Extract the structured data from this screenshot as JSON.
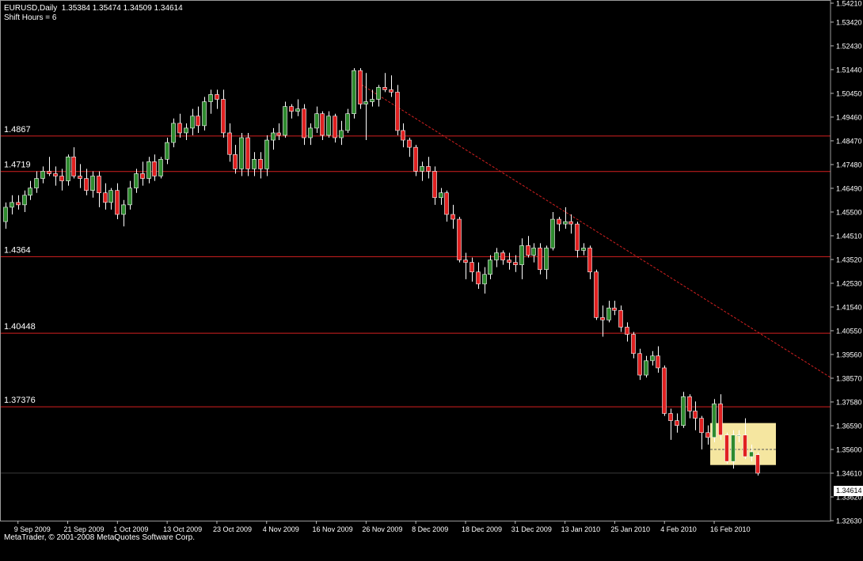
{
  "header": {
    "symbol_line": "EURUSD,Daily  1.35384 1.35474 1.34509 1.34614",
    "shift_line": "Shift Hours = 6"
  },
  "footer": {
    "copyright": "MetaTrader, © 2001-2008 MetaQuotes Software Corp."
  },
  "colors": {
    "background": "#000000",
    "bull": "#2e8b2e",
    "bear": "#e02020",
    "level_line": "#d42020",
    "grid": "#2a2a2a",
    "axis_text": "#ffffff",
    "highlight": "#f5e6a0"
  },
  "chart_data": {
    "type": "candlestick",
    "symbol": "EURUSD",
    "timeframe": "Daily",
    "current_price": "1.34614",
    "y_ticks": [
      "1.54210",
      "1.53420",
      "1.52430",
      "1.51440",
      "1.50450",
      "1.49460",
      "1.48470",
      "1.47480",
      "1.46490",
      "1.45500",
      "1.44510",
      "1.43520",
      "1.42530",
      "1.41540",
      "1.40550",
      "1.39560",
      "1.38570",
      "1.37580",
      "1.36590",
      "1.35600",
      "1.34610",
      "1.33620",
      "1.32630"
    ],
    "x_ticks": [
      "9 Sep 2009",
      "21 Sep 2009",
      "1 Oct 2009",
      "13 Oct 2009",
      "23 Oct 2009",
      "4 Nov 2009",
      "16 Nov 2009",
      "26 Nov 2009",
      "8 Dec 2009",
      "18 Dec 2009",
      "31 Dec 2009",
      "13 Jan 2010",
      "25 Jan 2010",
      "4 Feb 2010",
      "16 Feb 2010"
    ],
    "levels": [
      {
        "label": "1.4867",
        "value": 1.4867
      },
      {
        "label": "1.4719",
        "value": 1.4719
      },
      {
        "label": "1.4364",
        "value": 1.4364
      },
      {
        "label": "1.40448",
        "value": 1.40448
      },
      {
        "label": "1.37376",
        "value": 1.37376
      }
    ],
    "trendline": {
      "from": {
        "date": "27 Nov 2009",
        "price": 1.509
      },
      "to": {
        "date": "extends beyond 25 Feb 2010",
        "price": 1.386
      }
    },
    "highlight_box": {
      "from": "16 Feb 2010",
      "to": "25 Feb 2010",
      "price_high": 1.367,
      "price_low": 1.3495,
      "mid": 1.356
    },
    "candles": [
      {
        "date": "2009-09-07",
        "o": 1.451,
        "h": 1.459,
        "l": 1.448,
        "c": 1.457
      },
      {
        "date": "2009-09-08",
        "o": 1.457,
        "h": 1.462,
        "l": 1.454,
        "c": 1.459
      },
      {
        "date": "2009-09-09",
        "o": 1.459,
        "h": 1.462,
        "l": 1.456,
        "c": 1.458
      },
      {
        "date": "2009-09-10",
        "o": 1.458,
        "h": 1.464,
        "l": 1.455,
        "c": 1.462
      },
      {
        "date": "2009-09-11",
        "o": 1.462,
        "h": 1.468,
        "l": 1.46,
        "c": 1.465
      },
      {
        "date": "2009-09-14",
        "o": 1.465,
        "h": 1.472,
        "l": 1.463,
        "c": 1.469
      },
      {
        "date": "2009-09-15",
        "o": 1.469,
        "h": 1.474,
        "l": 1.467,
        "c": 1.472
      },
      {
        "date": "2009-09-16",
        "o": 1.472,
        "h": 1.478,
        "l": 1.47,
        "c": 1.471
      },
      {
        "date": "2009-09-17",
        "o": 1.471,
        "h": 1.474,
        "l": 1.466,
        "c": 1.47
      },
      {
        "date": "2009-09-18",
        "o": 1.47,
        "h": 1.473,
        "l": 1.464,
        "c": 1.468
      },
      {
        "date": "2009-09-21",
        "o": 1.468,
        "h": 1.479,
        "l": 1.466,
        "c": 1.478
      },
      {
        "date": "2009-09-22",
        "o": 1.478,
        "h": 1.482,
        "l": 1.469,
        "c": 1.47
      },
      {
        "date": "2009-09-23",
        "o": 1.47,
        "h": 1.475,
        "l": 1.465,
        "c": 1.469
      },
      {
        "date": "2009-09-24",
        "o": 1.469,
        "h": 1.473,
        "l": 1.462,
        "c": 1.464
      },
      {
        "date": "2009-09-25",
        "o": 1.464,
        "h": 1.472,
        "l": 1.461,
        "c": 1.47
      },
      {
        "date": "2009-09-28",
        "o": 1.47,
        "h": 1.472,
        "l": 1.457,
        "c": 1.463
      },
      {
        "date": "2009-09-29",
        "o": 1.463,
        "h": 1.467,
        "l": 1.456,
        "c": 1.459
      },
      {
        "date": "2009-09-30",
        "o": 1.459,
        "h": 1.465,
        "l": 1.456,
        "c": 1.464
      },
      {
        "date": "2009-10-01",
        "o": 1.464,
        "h": 1.467,
        "l": 1.452,
        "c": 1.454
      },
      {
        "date": "2009-10-02",
        "o": 1.454,
        "h": 1.46,
        "l": 1.449,
        "c": 1.458
      },
      {
        "date": "2009-10-05",
        "o": 1.458,
        "h": 1.468,
        "l": 1.456,
        "c": 1.465
      },
      {
        "date": "2009-10-06",
        "o": 1.465,
        "h": 1.473,
        "l": 1.463,
        "c": 1.471
      },
      {
        "date": "2009-10-07",
        "o": 1.471,
        "h": 1.476,
        "l": 1.466,
        "c": 1.469
      },
      {
        "date": "2009-10-08",
        "o": 1.469,
        "h": 1.478,
        "l": 1.467,
        "c": 1.476
      },
      {
        "date": "2009-10-09",
        "o": 1.476,
        "h": 1.479,
        "l": 1.468,
        "c": 1.47
      },
      {
        "date": "2009-10-12",
        "o": 1.47,
        "h": 1.478,
        "l": 1.469,
        "c": 1.477
      },
      {
        "date": "2009-10-13",
        "o": 1.477,
        "h": 1.486,
        "l": 1.475,
        "c": 1.484
      },
      {
        "date": "2009-10-14",
        "o": 1.484,
        "h": 1.494,
        "l": 1.482,
        "c": 1.492
      },
      {
        "date": "2009-10-15",
        "o": 1.492,
        "h": 1.496,
        "l": 1.486,
        "c": 1.488
      },
      {
        "date": "2009-10-16",
        "o": 1.488,
        "h": 1.492,
        "l": 1.485,
        "c": 1.49
      },
      {
        "date": "2009-10-19",
        "o": 1.49,
        "h": 1.498,
        "l": 1.487,
        "c": 1.495
      },
      {
        "date": "2009-10-20",
        "o": 1.495,
        "h": 1.499,
        "l": 1.488,
        "c": 1.491
      },
      {
        "date": "2009-10-21",
        "o": 1.491,
        "h": 1.503,
        "l": 1.489,
        "c": 1.501
      },
      {
        "date": "2009-10-22",
        "o": 1.501,
        "h": 1.506,
        "l": 1.496,
        "c": 1.504
      },
      {
        "date": "2009-10-23",
        "o": 1.504,
        "h": 1.506,
        "l": 1.498,
        "c": 1.502
      },
      {
        "date": "2009-10-26",
        "o": 1.502,
        "h": 1.506,
        "l": 1.486,
        "c": 1.488
      },
      {
        "date": "2009-10-27",
        "o": 1.488,
        "h": 1.492,
        "l": 1.476,
        "c": 1.479
      },
      {
        "date": "2009-10-28",
        "o": 1.479,
        "h": 1.483,
        "l": 1.471,
        "c": 1.473
      },
      {
        "date": "2009-10-29",
        "o": 1.473,
        "h": 1.488,
        "l": 1.47,
        "c": 1.486
      },
      {
        "date": "2009-10-30",
        "o": 1.486,
        "h": 1.488,
        "l": 1.47,
        "c": 1.473
      },
      {
        "date": "2009-11-02",
        "o": 1.473,
        "h": 1.48,
        "l": 1.47,
        "c": 1.477
      },
      {
        "date": "2009-11-03",
        "o": 1.477,
        "h": 1.48,
        "l": 1.469,
        "c": 1.473
      },
      {
        "date": "2009-11-04",
        "o": 1.473,
        "h": 1.487,
        "l": 1.47,
        "c": 1.485
      },
      {
        "date": "2009-11-05",
        "o": 1.485,
        "h": 1.49,
        "l": 1.481,
        "c": 1.488
      },
      {
        "date": "2009-11-06",
        "o": 1.488,
        "h": 1.492,
        "l": 1.485,
        "c": 1.487
      },
      {
        "date": "2009-11-09",
        "o": 1.487,
        "h": 1.501,
        "l": 1.486,
        "c": 1.499
      },
      {
        "date": "2009-11-10",
        "o": 1.499,
        "h": 1.5,
        "l": 1.494,
        "c": 1.497
      },
      {
        "date": "2009-11-11",
        "o": 1.497,
        "h": 1.502,
        "l": 1.495,
        "c": 1.498
      },
      {
        "date": "2009-11-12",
        "o": 1.498,
        "h": 1.5,
        "l": 1.483,
        "c": 1.486
      },
      {
        "date": "2009-11-13",
        "o": 1.486,
        "h": 1.492,
        "l": 1.483,
        "c": 1.49
      },
      {
        "date": "2009-11-16",
        "o": 1.49,
        "h": 1.499,
        "l": 1.488,
        "c": 1.496
      },
      {
        "date": "2009-11-17",
        "o": 1.496,
        "h": 1.497,
        "l": 1.485,
        "c": 1.487
      },
      {
        "date": "2009-11-18",
        "o": 1.487,
        "h": 1.497,
        "l": 1.486,
        "c": 1.495
      },
      {
        "date": "2009-11-19",
        "o": 1.495,
        "h": 1.496,
        "l": 1.484,
        "c": 1.486
      },
      {
        "date": "2009-11-20",
        "o": 1.486,
        "h": 1.493,
        "l": 1.483,
        "c": 1.489
      },
      {
        "date": "2009-11-23",
        "o": 1.489,
        "h": 1.498,
        "l": 1.488,
        "c": 1.496
      },
      {
        "date": "2009-11-24",
        "o": 1.496,
        "h": 1.515,
        "l": 1.494,
        "c": 1.514
      },
      {
        "date": "2009-11-25",
        "o": 1.514,
        "h": 1.515,
        "l": 1.498,
        "c": 1.5
      },
      {
        "date": "2009-11-26",
        "o": 1.5,
        "h": 1.513,
        "l": 1.485,
        "c": 1.501
      },
      {
        "date": "2009-11-27",
        "o": 1.501,
        "h": 1.506,
        "l": 1.499,
        "c": 1.502
      },
      {
        "date": "2009-11-30",
        "o": 1.502,
        "h": 1.508,
        "l": 1.499,
        "c": 1.507
      },
      {
        "date": "2009-12-01",
        "o": 1.507,
        "h": 1.513,
        "l": 1.505,
        "c": 1.506
      },
      {
        "date": "2009-12-02",
        "o": 1.506,
        "h": 1.512,
        "l": 1.503,
        "c": 1.505
      },
      {
        "date": "2009-12-03",
        "o": 1.505,
        "h": 1.508,
        "l": 1.487,
        "c": 1.489
      },
      {
        "date": "2009-12-04",
        "o": 1.489,
        "h": 1.492,
        "l": 1.482,
        "c": 1.485
      },
      {
        "date": "2009-12-07",
        "o": 1.485,
        "h": 1.486,
        "l": 1.478,
        "c": 1.482
      },
      {
        "date": "2009-12-08",
        "o": 1.482,
        "h": 1.483,
        "l": 1.47,
        "c": 1.472
      },
      {
        "date": "2009-12-09",
        "o": 1.472,
        "h": 1.476,
        "l": 1.468,
        "c": 1.474
      },
      {
        "date": "2009-12-10",
        "o": 1.474,
        "h": 1.478,
        "l": 1.469,
        "c": 1.472
      },
      {
        "date": "2009-12-11",
        "o": 1.472,
        "h": 1.474,
        "l": 1.458,
        "c": 1.461
      },
      {
        "date": "2009-12-14",
        "o": 1.461,
        "h": 1.465,
        "l": 1.458,
        "c": 1.463
      },
      {
        "date": "2009-12-15",
        "o": 1.463,
        "h": 1.464,
        "l": 1.451,
        "c": 1.454
      },
      {
        "date": "2009-12-16",
        "o": 1.454,
        "h": 1.458,
        "l": 1.448,
        "c": 1.452
      },
      {
        "date": "2009-12-17",
        "o": 1.452,
        "h": 1.453,
        "l": 1.434,
        "c": 1.435
      },
      {
        "date": "2009-12-18",
        "o": 1.435,
        "h": 1.438,
        "l": 1.427,
        "c": 1.434
      },
      {
        "date": "2009-12-21",
        "o": 1.434,
        "h": 1.436,
        "l": 1.426,
        "c": 1.43
      },
      {
        "date": "2009-12-22",
        "o": 1.43,
        "h": 1.434,
        "l": 1.423,
        "c": 1.425
      },
      {
        "date": "2009-12-23",
        "o": 1.425,
        "h": 1.432,
        "l": 1.421,
        "c": 1.429
      },
      {
        "date": "2009-12-24",
        "o": 1.429,
        "h": 1.437,
        "l": 1.427,
        "c": 1.435
      },
      {
        "date": "2009-12-28",
        "o": 1.435,
        "h": 1.44,
        "l": 1.432,
        "c": 1.438
      },
      {
        "date": "2009-12-29",
        "o": 1.438,
        "h": 1.439,
        "l": 1.433,
        "c": 1.435
      },
      {
        "date": "2009-12-30",
        "o": 1.435,
        "h": 1.438,
        "l": 1.431,
        "c": 1.434
      },
      {
        "date": "2009-12-31",
        "o": 1.434,
        "h": 1.437,
        "l": 1.43,
        "c": 1.433
      },
      {
        "date": "2010-01-04",
        "o": 1.433,
        "h": 1.444,
        "l": 1.427,
        "c": 1.441
      },
      {
        "date": "2010-01-05",
        "o": 1.441,
        "h": 1.445,
        "l": 1.436,
        "c": 1.437
      },
      {
        "date": "2010-01-06",
        "o": 1.437,
        "h": 1.442,
        "l": 1.434,
        "c": 1.44
      },
      {
        "date": "2010-01-07",
        "o": 1.44,
        "h": 1.442,
        "l": 1.429,
        "c": 1.431
      },
      {
        "date": "2010-01-08",
        "o": 1.431,
        "h": 1.441,
        "l": 1.427,
        "c": 1.44
      },
      {
        "date": "2010-01-11",
        "o": 1.44,
        "h": 1.455,
        "l": 1.439,
        "c": 1.452
      },
      {
        "date": "2010-01-12",
        "o": 1.452,
        "h": 1.453,
        "l": 1.447,
        "c": 1.45
      },
      {
        "date": "2010-01-13",
        "o": 1.45,
        "h": 1.457,
        "l": 1.448,
        "c": 1.451
      },
      {
        "date": "2010-01-14",
        "o": 1.451,
        "h": 1.454,
        "l": 1.446,
        "c": 1.45
      },
      {
        "date": "2010-01-15",
        "o": 1.45,
        "h": 1.451,
        "l": 1.436,
        "c": 1.439
      },
      {
        "date": "2010-01-18",
        "o": 1.439,
        "h": 1.442,
        "l": 1.437,
        "c": 1.44
      },
      {
        "date": "2010-01-19",
        "o": 1.44,
        "h": 1.441,
        "l": 1.427,
        "c": 1.43
      },
      {
        "date": "2010-01-20",
        "o": 1.43,
        "h": 1.431,
        "l": 1.41,
        "c": 1.411
      },
      {
        "date": "2010-01-21",
        "o": 1.411,
        "h": 1.416,
        "l": 1.403,
        "c": 1.41
      },
      {
        "date": "2010-01-22",
        "o": 1.41,
        "h": 1.418,
        "l": 1.409,
        "c": 1.415
      },
      {
        "date": "2010-01-25",
        "o": 1.415,
        "h": 1.418,
        "l": 1.412,
        "c": 1.414
      },
      {
        "date": "2010-01-26",
        "o": 1.414,
        "h": 1.416,
        "l": 1.405,
        "c": 1.407
      },
      {
        "date": "2010-01-27",
        "o": 1.407,
        "h": 1.409,
        "l": 1.401,
        "c": 1.404
      },
      {
        "date": "2010-01-28",
        "o": 1.404,
        "h": 1.405,
        "l": 1.394,
        "c": 1.396
      },
      {
        "date": "2010-01-29",
        "o": 1.396,
        "h": 1.398,
        "l": 1.385,
        "c": 1.387
      },
      {
        "date": "2010-02-01",
        "o": 1.387,
        "h": 1.395,
        "l": 1.386,
        "c": 1.393
      },
      {
        "date": "2010-02-02",
        "o": 1.393,
        "h": 1.397,
        "l": 1.391,
        "c": 1.395
      },
      {
        "date": "2010-02-03",
        "o": 1.395,
        "h": 1.399,
        "l": 1.388,
        "c": 1.39
      },
      {
        "date": "2010-02-04",
        "o": 1.39,
        "h": 1.391,
        "l": 1.37,
        "c": 1.371
      },
      {
        "date": "2010-02-05",
        "o": 1.371,
        "h": 1.373,
        "l": 1.36,
        "c": 1.368
      },
      {
        "date": "2010-02-08",
        "o": 1.368,
        "h": 1.371,
        "l": 1.363,
        "c": 1.366
      },
      {
        "date": "2010-02-09",
        "o": 1.366,
        "h": 1.38,
        "l": 1.365,
        "c": 1.378
      },
      {
        "date": "2010-02-10",
        "o": 1.378,
        "h": 1.379,
        "l": 1.369,
        "c": 1.372
      },
      {
        "date": "2010-02-11",
        "o": 1.372,
        "h": 1.376,
        "l": 1.364,
        "c": 1.369
      },
      {
        "date": "2010-02-12",
        "o": 1.369,
        "h": 1.37,
        "l": 1.356,
        "c": 1.363
      },
      {
        "date": "2010-02-15",
        "o": 1.363,
        "h": 1.366,
        "l": 1.358,
        "c": 1.361
      },
      {
        "date": "2010-02-16",
        "o": 1.361,
        "h": 1.377,
        "l": 1.359,
        "c": 1.375
      },
      {
        "date": "2010-02-17",
        "o": 1.375,
        "h": 1.379,
        "l": 1.36,
        "c": 1.362
      },
      {
        "date": "2010-02-18",
        "o": 1.362,
        "h": 1.363,
        "l": 1.35,
        "c": 1.351
      },
      {
        "date": "2010-02-19",
        "o": 1.351,
        "h": 1.364,
        "l": 1.348,
        "c": 1.362
      },
      {
        "date": "2010-02-22",
        "o": 1.362,
        "h": 1.364,
        "l": 1.359,
        "c": 1.362
      },
      {
        "date": "2010-02-23",
        "o": 1.362,
        "h": 1.369,
        "l": 1.352,
        "c": 1.353
      },
      {
        "date": "2010-02-24",
        "o": 1.353,
        "h": 1.358,
        "l": 1.351,
        "c": 1.355
      },
      {
        "date": "2010-02-25",
        "o": 1.3538,
        "h": 1.3547,
        "l": 1.3451,
        "c": 1.3461
      }
    ]
  }
}
